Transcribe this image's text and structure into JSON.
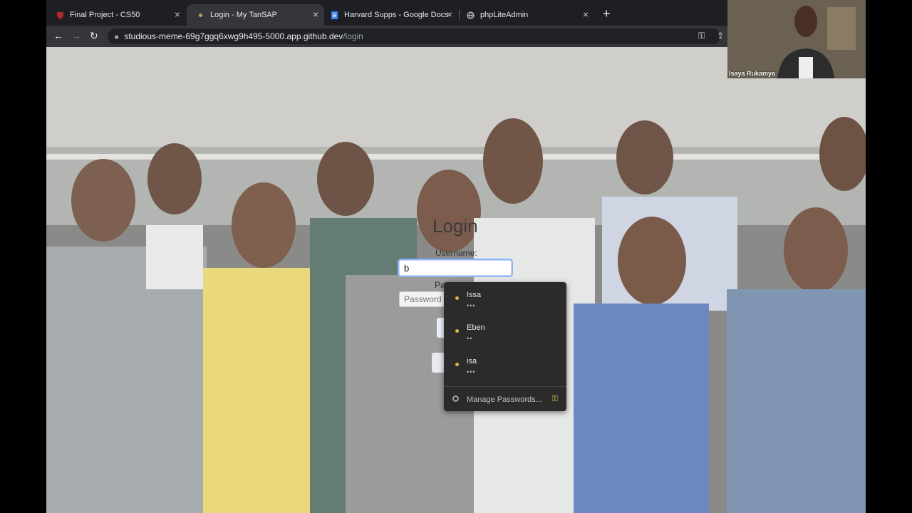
{
  "tabs": [
    {
      "title": "Final Project - CS50",
      "icon": "harvard-shield-icon"
    },
    {
      "title": "Login - My TanSAP",
      "icon": "site-favicon-icon",
      "active": true
    },
    {
      "title": "Harvard Supps - Google Docs",
      "icon": "google-docs-icon"
    },
    {
      "title": "phpLiteAdmin",
      "icon": "globe-icon"
    }
  ],
  "address": {
    "host": "studious-meme-69g7ggq6xwg9h495-5000.app.github.dev",
    "path": "/login"
  },
  "form": {
    "title": "Login",
    "username_label": "Username:",
    "username_value": "b",
    "password_label": "Password:",
    "password_placeholder": "Password"
  },
  "autofill": {
    "items": [
      {
        "name": "Issa",
        "mask": "•••"
      },
      {
        "name": "Eben",
        "mask": "••"
      },
      {
        "name": "isa",
        "mask": "•••"
      }
    ],
    "manage_label": "Manage Passwords..."
  },
  "webcam": {
    "name": "Isaya Rukamya"
  },
  "colors": {
    "tabstrip": "#1e1f22",
    "toolbar": "#35363a",
    "popup": "#2b2b2b",
    "key_accent": "#e8c750"
  }
}
